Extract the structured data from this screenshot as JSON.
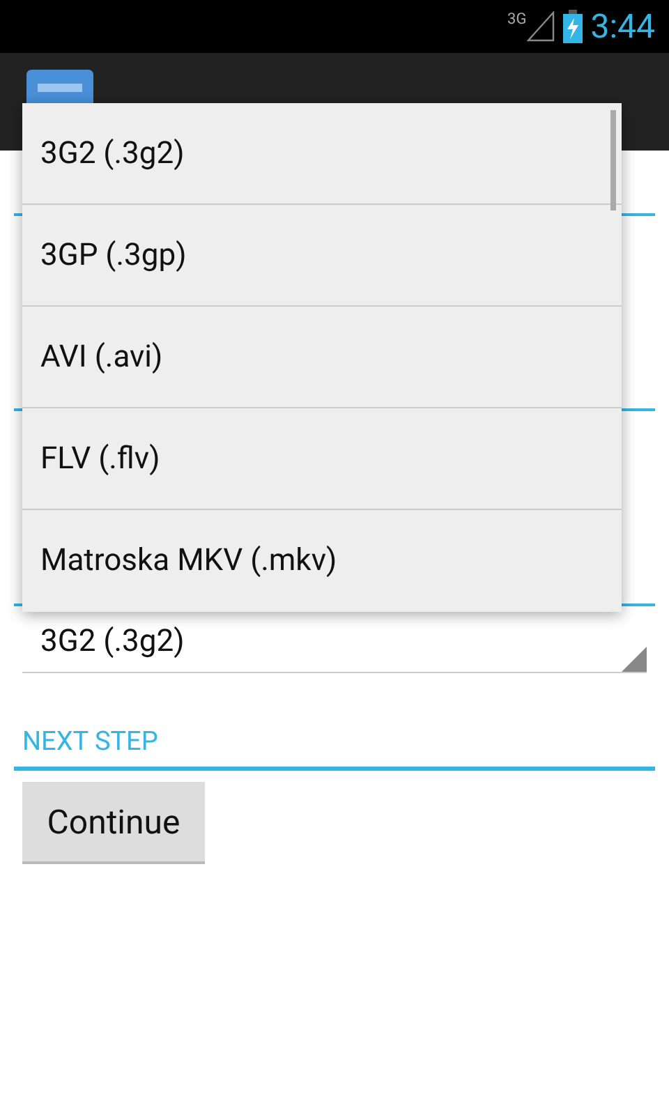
{
  "status_bar": {
    "network": "3G",
    "time": "3:44"
  },
  "format_spinner": {
    "value": "3G2 (.3g2)"
  },
  "dropdown": {
    "options": [
      "3G2 (.3g2)",
      "3GP (.3gp)",
      "AVI (.avi)",
      "FLV (.flv)",
      "Matroska MKV (.mkv)"
    ]
  },
  "next_step": {
    "header": "NEXT STEP",
    "button": "Continue"
  }
}
